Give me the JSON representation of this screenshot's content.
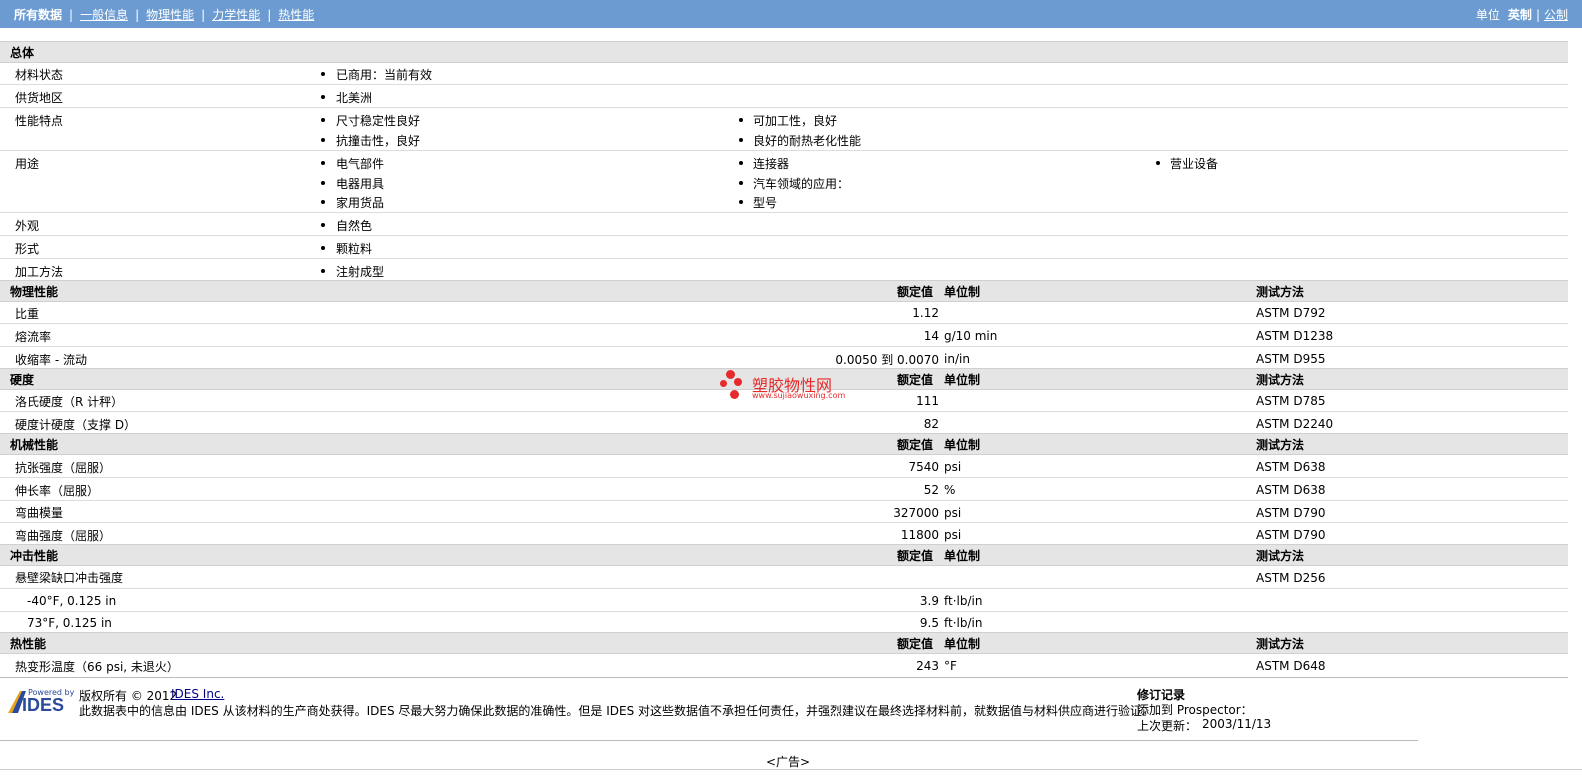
{
  "tabs": {
    "all": "所有数据",
    "general": "一般信息",
    "physical": "物理性能",
    "mechanical": "力学性能",
    "thermal": "热性能"
  },
  "units": {
    "label": "单位",
    "english": "英制",
    "metric": "公制"
  },
  "col_headers": {
    "nominal": "额定值",
    "unit": "单位制",
    "method": "测试方法"
  },
  "general": {
    "title": "总体",
    "status_label": "材料状态",
    "status": "已商用：当前有效",
    "region_label": "供货地区",
    "region": "北美洲",
    "features_label": "性能特点",
    "features": [
      "尺寸稳定性良好",
      "可加工性，良好",
      "抗撞击性，良好",
      "良好的耐热老化性能"
    ],
    "uses_label": "用途",
    "uses": [
      "电气部件",
      "连接器",
      "营业设备",
      "电器用具",
      "汽车领域的应用：",
      "家用货品",
      "型号"
    ],
    "appearance_label": "外观",
    "appearance": "自然色",
    "form_label": "形式",
    "form": "颗粒料",
    "process_label": "加工方法",
    "process": "注射成型"
  },
  "physical": {
    "title": "物理性能",
    "rows": [
      {
        "name": "比重",
        "value": "1.12",
        "unit": "",
        "method": "ASTM D792"
      },
      {
        "name": "熔流率",
        "value": "14",
        "unit": "g/10 min",
        "method": "ASTM D1238"
      },
      {
        "name": "收缩率 - 流动",
        "value": "0.0050 到  0.0070",
        "unit": "in/in",
        "method": "ASTM D955"
      }
    ]
  },
  "hardness": {
    "title": "硬度",
    "rows": [
      {
        "name": "洛氏硬度（R 计秤）",
        "value": "111",
        "unit": "",
        "method": "ASTM D785"
      },
      {
        "name": "硬度计硬度（支撑  D）",
        "value": "82",
        "unit": "",
        "method": "ASTM D2240"
      }
    ]
  },
  "mechanical": {
    "title": "机械性能",
    "rows": [
      {
        "name": "抗张强度（屈服）",
        "value": "7540",
        "unit": "psi",
        "method": "ASTM D638"
      },
      {
        "name": "伸长率（屈服）",
        "value": "52",
        "unit": "%",
        "method": "ASTM D638"
      },
      {
        "name": "弯曲模量",
        "value": "327000",
        "unit": "psi",
        "method": "ASTM D790"
      },
      {
        "name": "弯曲强度（屈服）",
        "value": "11800",
        "unit": "psi",
        "method": "ASTM D790"
      }
    ]
  },
  "impact": {
    "title": "冲击性能",
    "rows": [
      {
        "name": "悬壁梁缺口冲击强度",
        "value": "",
        "unit": "",
        "method": "ASTM D256"
      },
      {
        "name": "-40°F, 0.125 in",
        "value": "3.9",
        "unit": "ft·lb/in",
        "method": ""
      },
      {
        "name": "73°F, 0.125 in",
        "value": "9.5",
        "unit": "ft·lb/in",
        "method": ""
      }
    ]
  },
  "thermal": {
    "title": "热性能",
    "rows": [
      {
        "name": "热变形温度（66 psi, 未退火）",
        "value": "243",
        "unit": "°F",
        "method": "ASTM D648"
      }
    ]
  },
  "watermark": {
    "cn": "塑胶物性网",
    "url": "www.sujiaowuxing.com"
  },
  "footer": {
    "logo_top": "Powered by",
    "logo_main": "IDES",
    "copyright": "版权所有  © 2012",
    "company": "IDES Inc.",
    "disclaimer": "此数据表中的信息由  IDES 从该材料的生产商处获得。IDES 尽最大努力确保此数据的准确性。但是  IDES 对这些数据值不承担任何责任，并强烈建议在最终选择材料前，就数据值与材料供应商进行验证。",
    "revision_title": "修订记录",
    "added_to": "添加到  Prospector：",
    "last_update_label": "上次更新：",
    "last_update": "2003/11/13",
    "ad": "<广告>"
  }
}
